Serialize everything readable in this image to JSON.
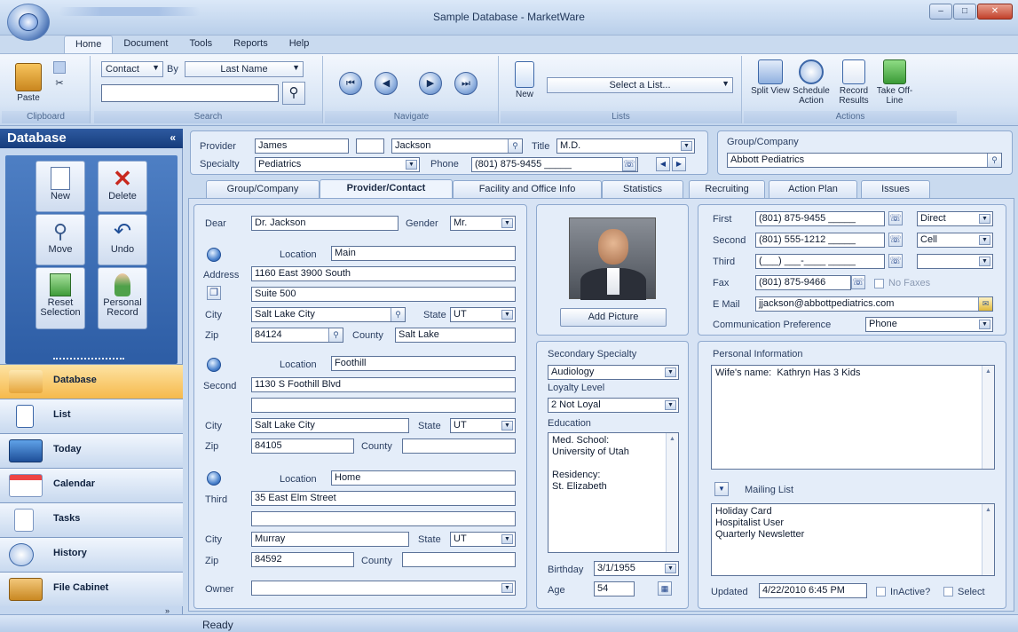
{
  "window": {
    "title": "Sample Database - MarketWare"
  },
  "menu": [
    "Home",
    "Document",
    "Tools",
    "Reports",
    "Help"
  ],
  "ribbon": {
    "clipboard": {
      "group": "Clipboard",
      "paste": "Paste"
    },
    "search": {
      "group": "Search",
      "field_combo": "Contact",
      "by_label": "By",
      "by_combo": "Last Name",
      "query": ""
    },
    "navigate": {
      "group": "Navigate"
    },
    "lists": {
      "group": "Lists",
      "new": "New",
      "select_list": "Select a List..."
    },
    "actions": {
      "group": "Actions",
      "split_view": "Split View",
      "schedule_action": "Schedule Action",
      "record_results": "Record Results",
      "take_offline": "Take Off-Line"
    }
  },
  "sidebar": {
    "title": "Database",
    "buttons": {
      "new": "New",
      "delete": "Delete",
      "move": "Move",
      "undo": "Undo",
      "reset": "Reset Selection",
      "personal": "Personal Record"
    },
    "nav": [
      "Database",
      "List",
      "Today",
      "Calendar",
      "Tasks",
      "History",
      "File Cabinet"
    ]
  },
  "provider": {
    "provider_label": "Provider",
    "first": "James",
    "middle": "",
    "last": "Jackson",
    "title_label": "Title",
    "title": "M.D.",
    "specialty_label": "Specialty",
    "specialty": "Pediatrics",
    "phone_label": "Phone",
    "phone": "(801) 875-9455 _____",
    "group_label": "Group/Company",
    "group": "Abbott Pediatrics"
  },
  "tabs": [
    "Group/Company",
    "Provider/Contact",
    "Facility and Office Info",
    "Statistics",
    "Recruiting",
    "Action Plan",
    "Issues"
  ],
  "contact": {
    "dear_label": "Dear",
    "dear": "Dr. Jackson",
    "gender_label": "Gender",
    "gender": "Mr.",
    "location_label": "Location",
    "address_label": "Address",
    "city_label": "City",
    "state_label": "State",
    "zip_label": "Zip",
    "county_label": "County",
    "owner_label": "Owner",
    "addr1": {
      "location": "Main",
      "line1": "1160 East 3900 South",
      "line2": "Suite 500",
      "city": "Salt Lake City",
      "state": "UT",
      "zip": "84124",
      "county": "Salt Lake"
    },
    "addr2": {
      "label": "Second",
      "location": "Foothill",
      "line1": "1130 S Foothill Blvd",
      "line2": "",
      "city": "Salt Lake City",
      "state": "UT",
      "zip": "84105",
      "county": ""
    },
    "addr3": {
      "label": "Third",
      "location": "Home",
      "line1": "35 East Elm Street",
      "line2": "",
      "city": "Murray",
      "state": "UT",
      "zip": "84592",
      "county": ""
    },
    "owner": ""
  },
  "photo": {
    "add_picture": "Add Picture"
  },
  "secondary": {
    "specialty_label": "Secondary Specialty",
    "specialty": "Audiology",
    "loyalty_label": "Loyalty Level",
    "loyalty": "2 Not Loyal",
    "education_label": "Education",
    "education": "Med. School:\nUniversity of Utah\n\nResidency:\nSt. Elizabeth",
    "birthday_label": "Birthday",
    "birthday": "3/1/1955",
    "age_label": "Age",
    "age": "54"
  },
  "phones": {
    "first_label": "First",
    "first": "(801) 875-9455 _____",
    "first_type": "Direct",
    "second_label": "Second",
    "second": "(801) 555-1212 _____",
    "second_type": "Cell",
    "third_label": "Third",
    "third": "(___) ___-____ _____",
    "third_type": "",
    "fax_label": "Fax",
    "fax": "(801) 875-9466",
    "no_faxes": "No Faxes",
    "email_label": "E Mail",
    "email": "jjackson@abbottpediatrics.com",
    "comm_label": "Communication Preference",
    "comm": "Phone"
  },
  "personal": {
    "label": "Personal Information",
    "text": "Wife's name:  Kathryn Has 3 Kids",
    "mailing_label": "Mailing List",
    "mailing": "Holiday Card\nHospitalist User\nQuarterly Newsletter",
    "updated_label": "Updated",
    "updated": "4/22/2010 6:45 PM",
    "inactive": "InActive?",
    "select": "Select"
  },
  "status": "Ready"
}
